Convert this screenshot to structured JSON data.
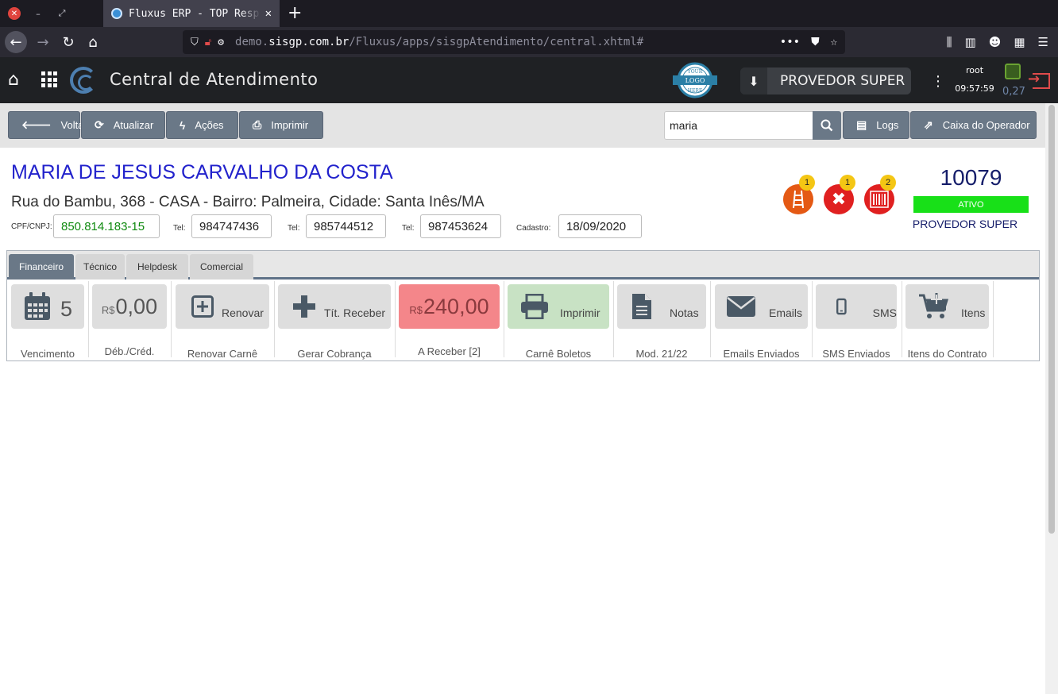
{
  "browser": {
    "tab_title": "Fluxus ERP - TOP Resp",
    "url_prefix": "demo.",
    "url_domain": "sisgp.com.br",
    "url_path": "/Fluxus/apps/sisgpAtendimento/central.xhtml#"
  },
  "app": {
    "title": "Central de Atendimento",
    "provider_button": "PROVEDOR SUPER",
    "user": "root",
    "time": "09:57:59",
    "load": "0,27",
    "logo_lines": [
      "YOUR",
      "LOGO",
      "HERE"
    ]
  },
  "toolbar": {
    "back": "Voltar",
    "refresh": "Atualizar",
    "actions": "Ações",
    "print": "Imprimir",
    "search_value": "maria",
    "logs": "Logs",
    "operator_cash": "Caixa do Operador"
  },
  "customer": {
    "name": "MARIA DE JESUS CARVALHO DA COSTA",
    "address": "Rua do Bambu, 368 - CASA - Bairro: Palmeira, Cidade: Santa Inês/MA",
    "cpf_label": "CPF/CNPJ:",
    "cpf": "850.814.183-15",
    "tel_label": "Tel:",
    "tel1": "984747436",
    "tel2": "985744512",
    "tel3": "987453624",
    "register_label": "Cadastro:",
    "register_date": "18/09/2020",
    "id": "10079",
    "status": "ATIVO",
    "provider": "PROVEDOR SUPER",
    "badges": {
      "network": "1",
      "blocked": "1",
      "barcode": "2"
    },
    "colors": {
      "name": "#2222cc",
      "status_bg": "#18e018",
      "alert": "#e45914",
      "blocked": "#e02020"
    }
  },
  "tabs": [
    "Financeiro",
    "Técnico",
    "Helpdesk",
    "Comercial"
  ],
  "tiles": {
    "due_value": "5",
    "due_label": "Vencimento",
    "debit_currency": "R$",
    "debit_value": "0,00",
    "debit_label": "Déb./Créd.",
    "renew_text": "Renovar",
    "renew_label": "Renovar Carnê",
    "receive_text": "Tít. Receber",
    "receive_label": "Gerar Cobrança",
    "receivable_currency": "R$",
    "receivable_value": "240,00",
    "receivable_label": "A Receber [2]",
    "print_text": "Imprimir",
    "print_label": "Carnê Boletos",
    "notes_text": "Notas",
    "notes_label": "Mod. 21/22",
    "emails_text": "Emails",
    "emails_label": "Emails Enviados",
    "sms_text": "SMS",
    "sms_label": "SMS Enviados",
    "items_text": "Itens",
    "items_label": "Itens do Contrato"
  }
}
